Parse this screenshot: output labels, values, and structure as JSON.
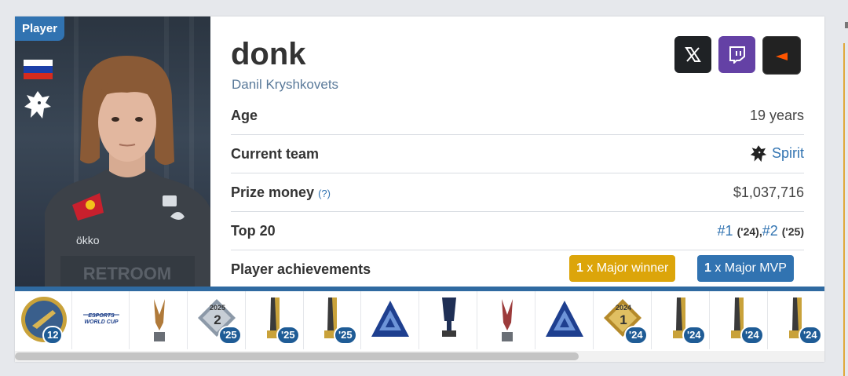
{
  "player": {
    "tag": "Player",
    "nickname": "donk",
    "real_name": "Danil Kryshkovets",
    "flag": "russia-flag",
    "team_logo": "spirit-dragon-logo"
  },
  "social": [
    {
      "name": "x-twitter-icon",
      "color": "#1f2225"
    },
    {
      "name": "twitch-icon",
      "color": "#6441a5"
    },
    {
      "name": "faceit-icon",
      "color": "#222222",
      "accent": "#ff5500"
    }
  ],
  "info": {
    "age_label": "Age",
    "age_value": "19 years",
    "team_label": "Current team",
    "team_value": "Spirit",
    "prize_label": "Prize money",
    "prize_help": "(?)",
    "prize_value": "$1,037,716",
    "top20_label": "Top 20",
    "top20_rank1": "#1",
    "top20_year1": "('24)",
    "top20_sep": ",",
    "top20_rank2": "#2",
    "top20_year2": "('25)",
    "achievements_label": "Player achievements"
  },
  "achievements": [
    {
      "count": "1",
      "text": " x Major winner",
      "color": "#dca50a"
    },
    {
      "count": "1",
      "text": " x Major MVP",
      "color": "#3173b1"
    }
  ],
  "trophies": [
    {
      "icon": "gold-medal-icon",
      "badge": "12"
    },
    {
      "icon": "esports-world-cup-logo",
      "badge": "",
      "text": "ESPORTS WORLD CUP"
    },
    {
      "icon": "bronze-trophy-icon",
      "badge": ""
    },
    {
      "icon": "diamond-award-icon",
      "badge": "'25",
      "year": "2025",
      "num": "2"
    },
    {
      "icon": "gold-trophy-icon",
      "badge": "'25"
    },
    {
      "icon": "gold-trophy-icon",
      "badge": "'25"
    },
    {
      "icon": "blast-triangle-icon",
      "badge": ""
    },
    {
      "icon": "blue-cup-icon",
      "badge": ""
    },
    {
      "icon": "red-trophy-icon",
      "badge": ""
    },
    {
      "icon": "blast-triangle-icon",
      "badge": ""
    },
    {
      "icon": "diamond-award-icon",
      "badge": "'24",
      "year": "2024",
      "num": "1"
    },
    {
      "icon": "gold-trophy-icon",
      "badge": "'24"
    },
    {
      "icon": "gold-trophy-icon",
      "badge": "'24"
    },
    {
      "icon": "gold-trophy-icon",
      "badge": "'24"
    }
  ],
  "colors": {
    "accent": "#3173b1",
    "strip": "#2f6aa1",
    "badge": "#1f5c96"
  }
}
